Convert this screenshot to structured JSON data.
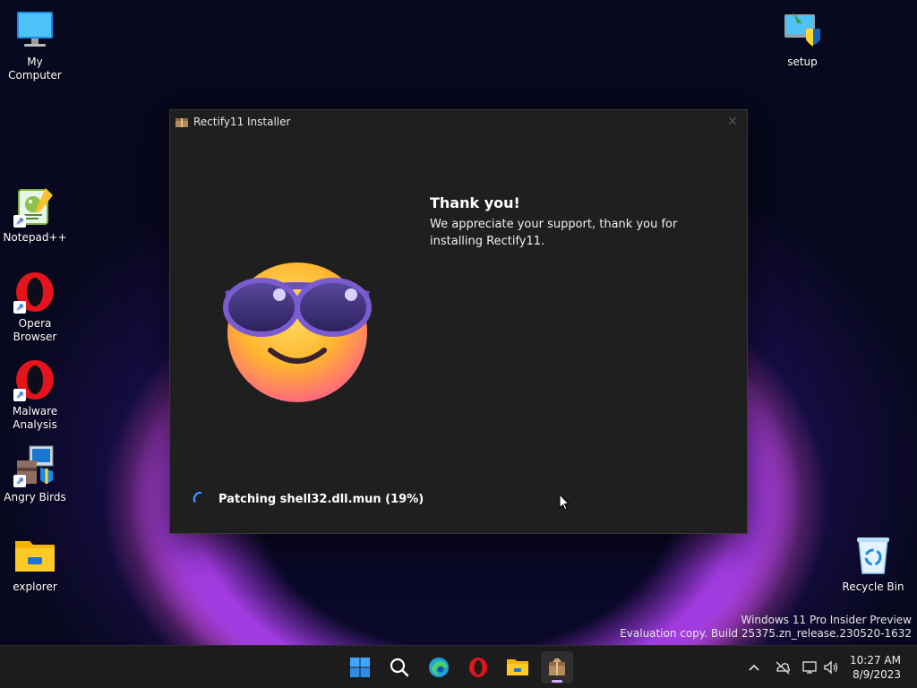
{
  "desktop": {
    "icons": [
      {
        "label": "My Computer",
        "icon": "computer-icon"
      },
      {
        "label": "Notepad++",
        "icon": "notepadpp-icon"
      },
      {
        "label": "Opera Browser",
        "icon": "opera-icon"
      },
      {
        "label": "Malware Analysis",
        "icon": "opera-icon"
      },
      {
        "label": "Angry Birds",
        "icon": "installer-icon"
      },
      {
        "label": "explorer",
        "icon": "folder-icon"
      },
      {
        "label": "setup",
        "icon": "setup-shield-icon"
      },
      {
        "label": "Recycle Bin",
        "icon": "recycle-bin-icon"
      }
    ]
  },
  "installer": {
    "title": "Rectify11 Installer",
    "heading": "Thank you!",
    "message": "We appreciate your support, thank you for installing Rectify11.",
    "status": "Patching shell32.dll.mun (19%)",
    "progress_percent": 19
  },
  "watermark": {
    "line1": "Windows 11 Pro Insider Preview",
    "line2": "Evaluation copy. Build 25375.zn_release.230520-1632"
  },
  "taskbar": {
    "apps": [
      "start-icon",
      "search-icon",
      "edge-icon",
      "opera-icon",
      "file-explorer-icon",
      "installer-icon"
    ],
    "tray": [
      "chevron-up-icon",
      "network-off-icon",
      "display-icon",
      "volume-icon"
    ],
    "time": "10:27 AM",
    "date": "8/9/2023"
  },
  "colors": {
    "window_bg": "#1f1f1f",
    "taskbar_bg": "#1c1c1c",
    "accent": "#0078d4",
    "active_indicator": "#d9a6ff"
  }
}
